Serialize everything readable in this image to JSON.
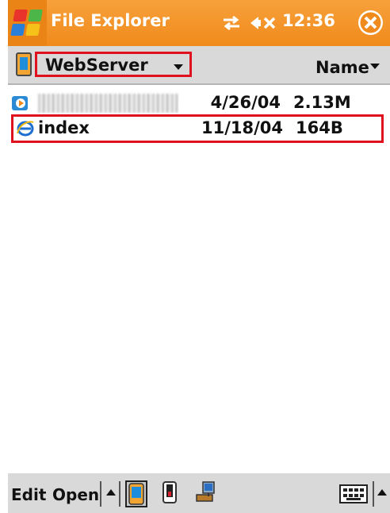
{
  "title_bar": {
    "app_title": "File Explorer",
    "time": "12:36"
  },
  "location_bar": {
    "folder": "WebServer",
    "sort_by": "Name"
  },
  "files": [
    {
      "name": "",
      "date": "4/26/04",
      "size": "2.13M",
      "icon": "media-file-icon",
      "name_obscured": true
    },
    {
      "name": "index",
      "date": "11/18/04",
      "size": "164B",
      "icon": "ie-html-file-icon",
      "selected": true
    }
  ],
  "toolbar": {
    "edit": "Edit",
    "open": "Open"
  },
  "colors": {
    "title_bar": "#f08a1c",
    "highlight": "#e0101f",
    "bar_gray": "#d9d9d9"
  }
}
